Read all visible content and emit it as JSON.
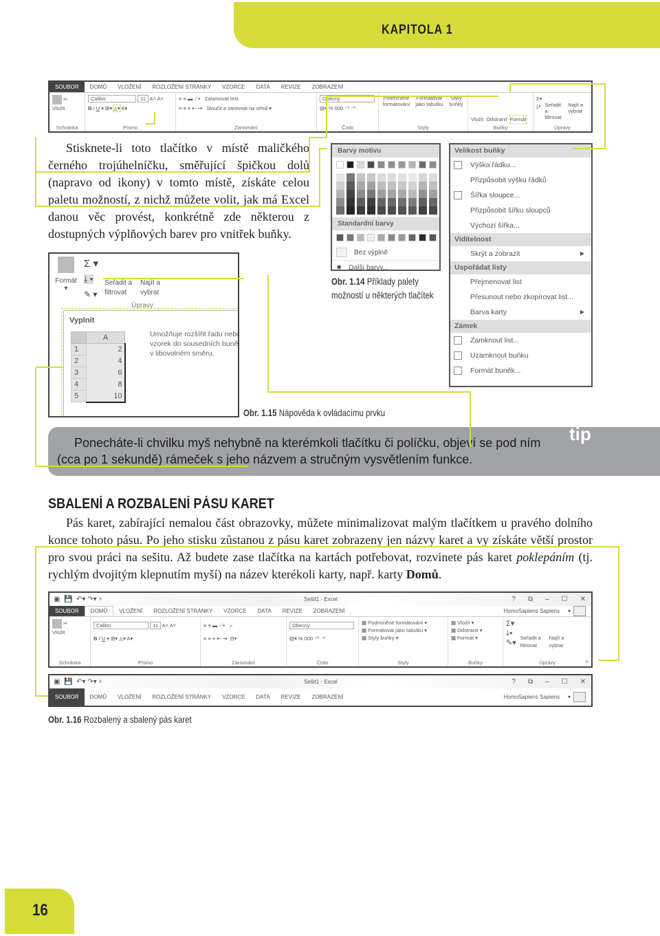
{
  "header": {
    "chapter": "KAPITOLA 1"
  },
  "ribbon1": {
    "tabs": [
      "SOUBOR",
      "DOMŮ",
      "VLOŽENÍ",
      "ROZLOŽENÍ STRÁNKY",
      "VZORCE",
      "DATA",
      "REVIZE",
      "ZOBRAZENÍ"
    ],
    "paste": "Vložit",
    "font": "Calibri",
    "size": "11",
    "wrap": "Zalamovat text",
    "merge": "Sloučit a zarovnat na střed",
    "number_format": "Obecný",
    "cond": "Podmíněné formátování",
    "table": "Formátovat jako tabulku",
    "styles": "Styly buňky",
    "insert": "Vložit",
    "delete": "Odstranit",
    "format": "Formát",
    "sort": "Seřadit a filtrovat",
    "find": "Najít a vybrat",
    "groups": [
      "Schránka",
      "Písmo",
      "Zarovnání",
      "Číslo",
      "Styly",
      "Buňky",
      "Úpravy"
    ]
  },
  "left_paragraph": "Stisknete-li toto tlačítko v místě maličkého černého trojúhelníčku, směřující špičkou dolů (napravo od ikony) v tomto místě, získáte celou paletu možností, z nichž můžete volit, jak má Excel danou věc provést, konkrétně zde některou z dostupných výplňových barev pro vnitřek buňky.",
  "palette": {
    "theme_title": "Barvy motivu",
    "theme_colors": [
      "#ffffff",
      "#1e1e1e",
      "#d8d8d8",
      "#4a4a4a",
      "#8a8a8a",
      "#8f8f8f",
      "#9a9a9a",
      "#b4b4b4",
      "#6a6a6a",
      "#8c8c8c"
    ],
    "shades": [
      [
        "#e6e6e6",
        "#7a7a7a",
        "#c4c4c4",
        "#c8c8c8",
        "#dadada",
        "#dcdcdc",
        "#e0e0e0",
        "#e8e8e8",
        "#d6d6d6",
        "#dddddd"
      ],
      [
        "#cfcfcf",
        "#5c5c5c",
        "#a8a8a8",
        "#a0a0a0",
        "#bdbdbd",
        "#c2c2c2",
        "#c8c8c8",
        "#d2d2d2",
        "#b4b4b4",
        "#c0c0c0"
      ],
      [
        "#b4b4b4",
        "#444444",
        "#8c8c8c",
        "#777777",
        "#9e9e9e",
        "#a4a4a4",
        "#aaaaaa",
        "#bababa",
        "#939393",
        "#a2a2a2"
      ],
      [
        "#8e8e8e",
        "#333333",
        "#5c5c5c",
        "#3f3f3f",
        "#666666",
        "#6a6a6a",
        "#707070",
        "#7c7c7c",
        "#5f5f5f",
        "#686868"
      ],
      [
        "#6e6e6e",
        "#262626",
        "#3c3c3c",
        "#2e2e2e",
        "#4a4a4a",
        "#4d4d4d",
        "#525252",
        "#5a5a5a",
        "#434343",
        "#4a4a4a"
      ]
    ],
    "standard_title": "Standardní barvy",
    "standard_colors": [
      "#5a5a5a",
      "#777777",
      "#bbbbbb",
      "#eeeeee",
      "#aaaaaa",
      "#888888",
      "#999999",
      "#666666",
      "#2a2a2a",
      "#555555"
    ],
    "no_fill": "Bez výplně",
    "more": "Další barvy..."
  },
  "caption14": {
    "num": "Obr. 1.14",
    "text_line1": "Příklady palety",
    "text_line2": "možností u některých tlačítek"
  },
  "format_menu": [
    {
      "type": "header",
      "label": "Velikost buňky"
    },
    {
      "type": "item",
      "label": "Výška řádku...",
      "icon": "row-height-icon"
    },
    {
      "type": "item",
      "label": "Přizpůsobit výšku řádků"
    },
    {
      "type": "item",
      "label": "Šířka sloupce...",
      "icon": "column-width-icon"
    },
    {
      "type": "item",
      "label": "Přizpůsobit šířku sloupců"
    },
    {
      "type": "item",
      "label": "Výchozí šířka..."
    },
    {
      "type": "header",
      "label": "Viditelnost"
    },
    {
      "type": "item",
      "label": "Skrýt a zobrazit",
      "submenu": true
    },
    {
      "type": "header",
      "label": "Uspořádat listy"
    },
    {
      "type": "item",
      "label": "Přejmenovat list"
    },
    {
      "type": "item",
      "label": "Přesunout nebo zkopírovat list..."
    },
    {
      "type": "item",
      "label": "Barva karty",
      "submenu": true
    },
    {
      "type": "header",
      "label": "Zámek"
    },
    {
      "type": "item",
      "label": "Zamknout list...",
      "icon": "protect-sheet-icon"
    },
    {
      "type": "item",
      "label": "Uzamknout buňku",
      "icon": "lock-icon"
    },
    {
      "type": "item",
      "label": "Formát buněk...",
      "icon": "format-cells-icon"
    }
  ],
  "fig15": {
    "format": "Formát",
    "sort": "Seřadit a filtrovat",
    "find": "Najít a vybrat",
    "group": "Úpravy",
    "tooltip_title": "Vyplnit",
    "tooltip_text": "Umožňuje rozšířit řadu nebo vzorek do sousedních buněk v libovolném směru.",
    "col": "A",
    "rows": [
      "1",
      "2",
      "3",
      "4",
      "5"
    ],
    "values": [
      "2",
      "4",
      "6",
      "8",
      "10"
    ]
  },
  "caption15": {
    "num": "Obr. 1.15",
    "text": "Nápověda k ovládacímu prvku"
  },
  "tip": {
    "label": "tip",
    "text": "Ponecháte-li chvilku myš nehybně na kterémkoli tlačítku či políčku, objeví se pod ním (cca po 1 sekundě) rámeček s jeho názvem a stručným vysvětlením funkce."
  },
  "section": {
    "heading": "SBALENÍ A ROZBALENÍ PÁSU KARET",
    "p1": "Pás karet, zabírající nemalou část obrazovky, můžete minimalizovat malým tlačítkem u pravého dolního konce tohoto pásu. Po jeho stisku zůstanou z pásu karet zobrazeny jen názvy karet a vy získáte větší prostor pro svou práci na sešitu. Až budete zase tlačítka na kartách potřebovat, rozvinete pás karet ",
    "em": "poklepáním",
    "p2": " (tj. rychlým dvojitým klepnutím myší) na název kterékoli karty, např. karty ",
    "strong": "Domů",
    "p3": "."
  },
  "ribbon2": {
    "title": "Sešit1 - Excel",
    "user": "HomoSapiens Sapiens",
    "win": [
      "?",
      "⧉",
      "–",
      "☐",
      "✕"
    ],
    "cond": "Podmíněné formátování",
    "table": "Formátovat jako tabulku",
    "styles": "Styly buňky",
    "insert": "Vložit",
    "delete": "Odstranit",
    "format": "Formát"
  },
  "caption16": {
    "num": "Obr. 1.16",
    "text": "Rozbalený a sbalený pás karet"
  },
  "page_number": "16",
  "colors": {
    "accent": "#d5dc3a",
    "tip_bg": "#a1a3a6",
    "file_tab": "#444444"
  }
}
